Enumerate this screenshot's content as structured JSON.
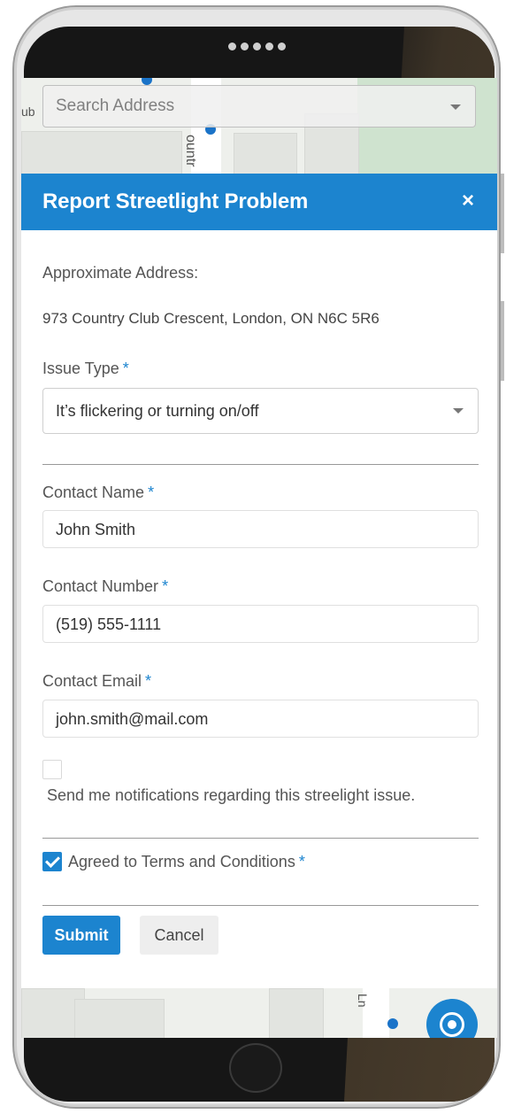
{
  "map": {
    "search_placeholder": "Search Address",
    "street_label_left": "ub",
    "street_label_vertical": "ountr",
    "street_label_bottom": "Ln"
  },
  "modal": {
    "title": "Report Streetlight Problem",
    "close_label": "×",
    "approx_address_label": "Approximate Address:",
    "address_value": "973 Country Club Crescent, London, ON N6C 5R6",
    "issue_type_label": "Issue Type",
    "issue_type_value": "It’s flickering or turning on/off",
    "contact_name_label": "Contact Name",
    "contact_name_value": "John Smith",
    "contact_number_label": "Contact Number",
    "contact_number_value": "(519) 555-1111",
    "contact_email_label": "Contact Email",
    "contact_email_value": "john.smith@mail.com",
    "notify_label": "Send me notifications regarding this streelight issue.",
    "terms_label": "Agreed to Terms and Conditions",
    "required_marker": "*",
    "submit_label": "Submit",
    "cancel_label": "Cancel"
  },
  "colors": {
    "accent": "#1c84cf",
    "phone_frame": "#161616"
  },
  "icons": {
    "close": "close-icon",
    "dropdown": "chevron-down-icon",
    "locate": "locate-icon",
    "check": "check-icon"
  }
}
